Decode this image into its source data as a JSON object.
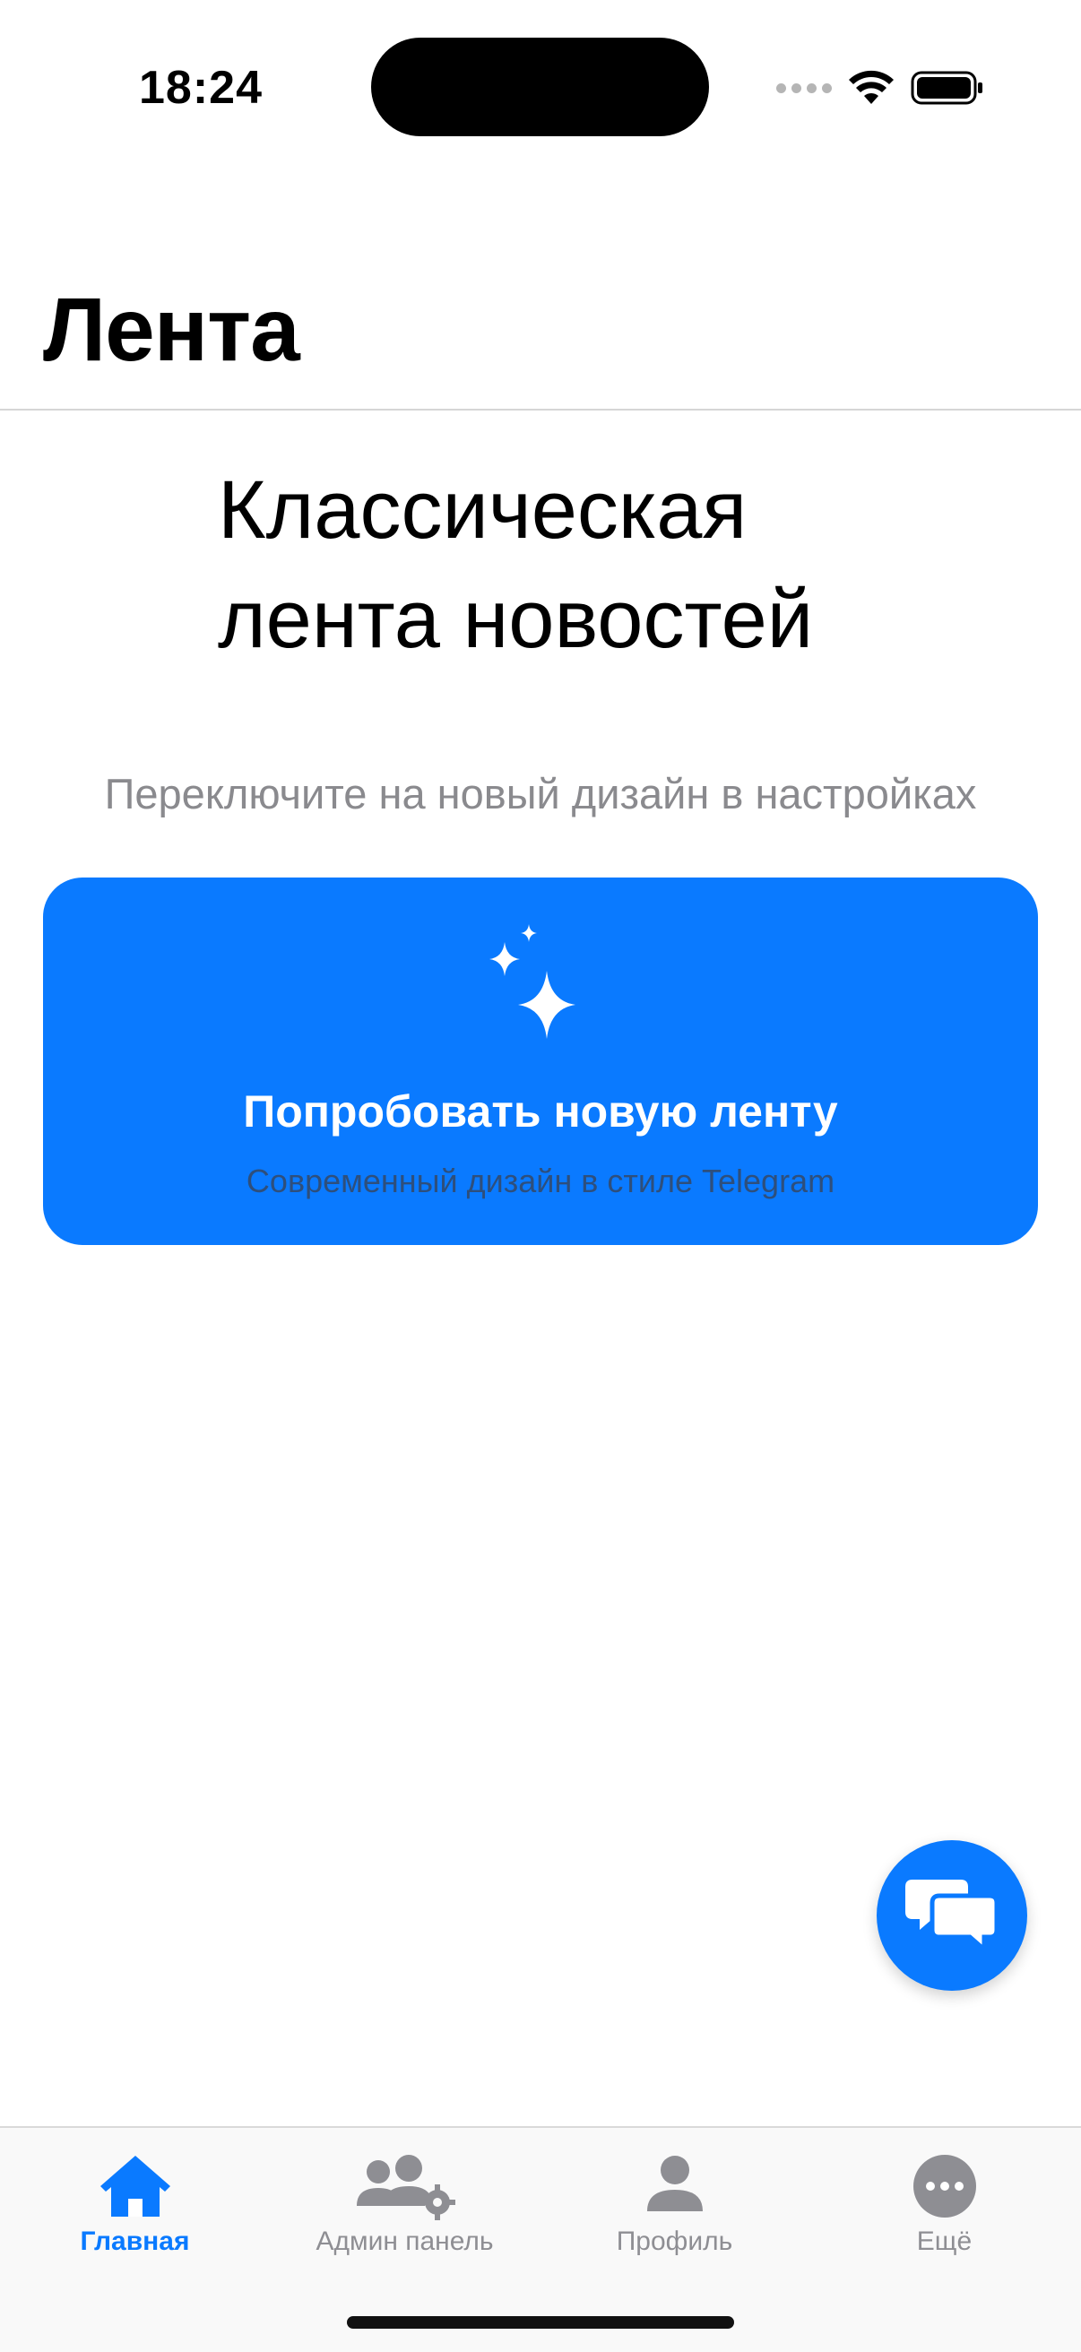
{
  "status_bar": {
    "time": "18:24"
  },
  "nav": {
    "title": "Лента"
  },
  "main": {
    "headline_line1": "Классическая",
    "headline_line2": "лента новостей",
    "hint": "Переключите на новый дизайн в настройках",
    "promo": {
      "icon": "sparkles-icon",
      "title": "Попробовать новую ленту",
      "subtitle": "Современный дизайн в стиле Telegram"
    }
  },
  "fab": {
    "icon": "chat-bubbles-icon"
  },
  "tabbar": {
    "items": [
      {
        "label": "Главная",
        "icon": "house-icon",
        "active": true
      },
      {
        "label": "Админ панель",
        "icon": "users-gear-icon",
        "active": false
      },
      {
        "label": "Профиль",
        "icon": "person-icon",
        "active": false
      },
      {
        "label": "Ещё",
        "icon": "ellipsis-circle-icon",
        "active": false
      }
    ]
  },
  "colors": {
    "accent": "#0A7AFF",
    "inactive": "#8E8E93",
    "hint": "#8A8A8E",
    "promo_subtitle": "#2E4F7C"
  }
}
